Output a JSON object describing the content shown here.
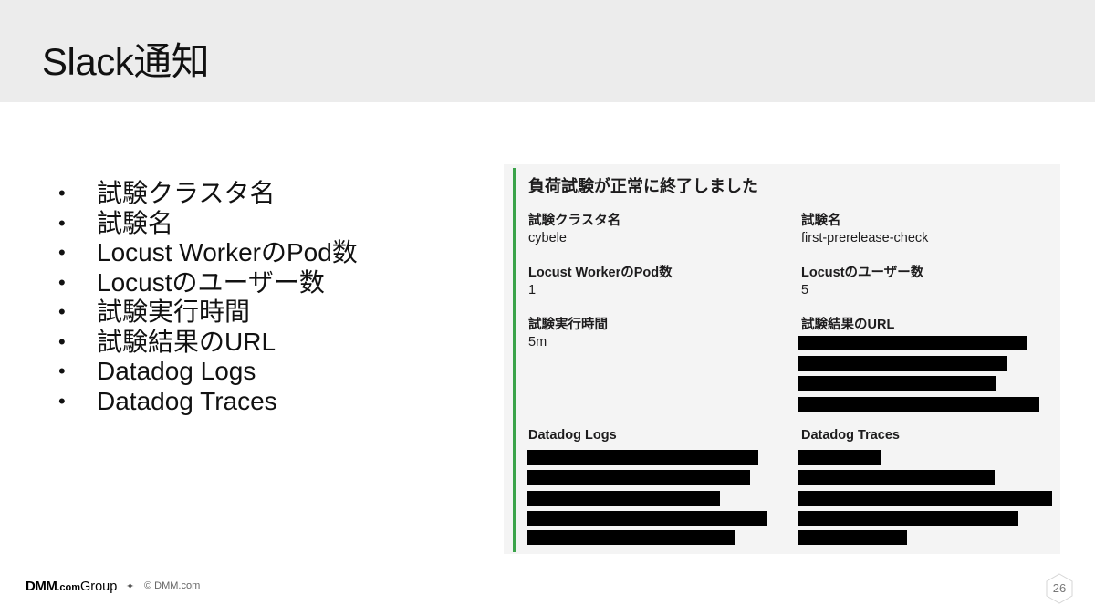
{
  "slide": {
    "title": "Slack通知",
    "bullet_marker": "•",
    "bullets": [
      "試験クラスタ名",
      "試験名",
      "Locust WorkerのPod数",
      "Locustのユーザー数",
      "試験実行時間",
      "試験結果のURL",
      "Datadog Logs",
      "Datadog Traces"
    ]
  },
  "notification": {
    "accent_color": "#3aa34a",
    "heading": "負荷試験が正常に終了しました",
    "fields": {
      "cluster_name": {
        "label": "試験クラスタ名",
        "value": "cybele"
      },
      "test_name": {
        "label": "試験名",
        "value": "first-prerelease-check"
      },
      "worker_pods": {
        "label": "Locust WorkerのPod数",
        "value": "1"
      },
      "users": {
        "label": "Locustのユーザー数",
        "value": "5"
      },
      "duration": {
        "label": "試験実行時間",
        "value": "5m"
      },
      "result_url": {
        "label": "試験結果のURL"
      },
      "datadog_logs": {
        "label": "Datadog Logs"
      },
      "datadog_traces": {
        "label": "Datadog Traces"
      }
    }
  },
  "footer": {
    "logo_dmm": "DMM",
    "logo_com": ".com",
    "logo_group": "Group",
    "copyright": "© DMM.com",
    "page_number": "26"
  }
}
